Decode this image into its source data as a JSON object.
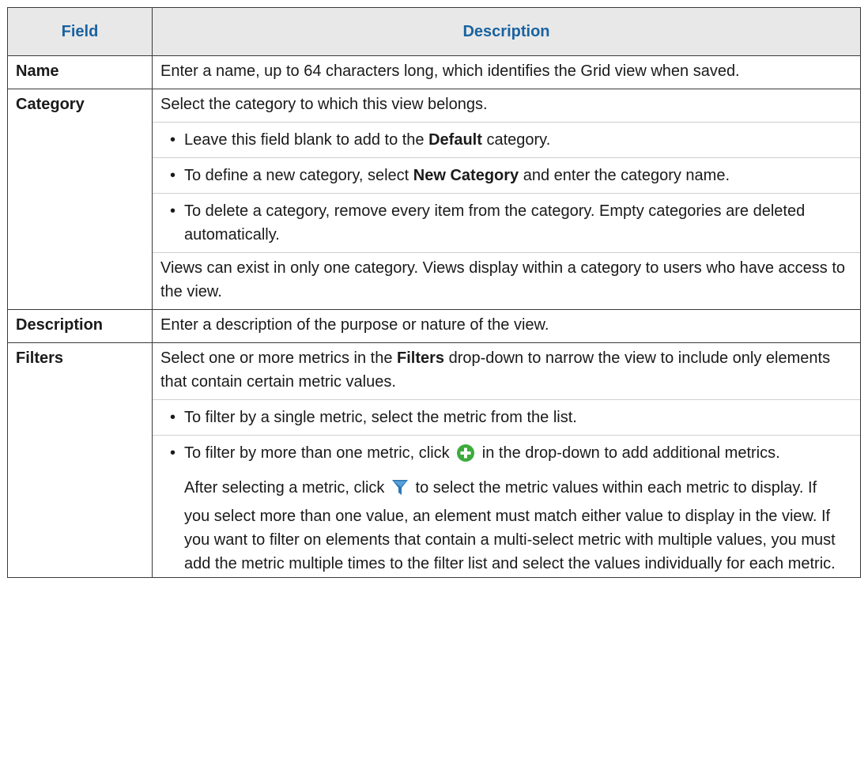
{
  "table": {
    "header": {
      "field": "Field",
      "description": "Description"
    },
    "rows": {
      "name": {
        "field": "Name",
        "text": "Enter a name, up to 64 characters long, which identifies the Grid view when saved."
      },
      "category": {
        "field": "Category",
        "intro": "Select the category to which this view belongs.",
        "bullet1": {
          "before": "Leave this field blank to add to the ",
          "bold": "Default",
          "after": " category."
        },
        "bullet2": {
          "before": "To define a new category, select ",
          "bold": "New Category",
          "after": " and enter the category name."
        },
        "bullet3": {
          "text": "To delete a category, remove every item from the category. Empty categories are deleted automatically."
        },
        "outro": "Views can exist in only one category. Views display within a category to users who have access to the view."
      },
      "description": {
        "field": "Description",
        "text": "Enter a description of the purpose or nature of the view."
      },
      "filters": {
        "field": "Filters",
        "intro_before": "Select one or more metrics in the ",
        "intro_bold": "Filters",
        "intro_after": " drop-down to narrow the view to include only elements that contain certain metric values.",
        "bullet1": "To filter by a single metric, select the metric from the list.",
        "bullet2_before": "To filter by more than one metric, click ",
        "bullet2_after": " in the drop-down to add additional metrics.",
        "bullet2_extra_before": "After selecting a metric, click ",
        "bullet2_extra_after": " to select the metric values within each metric to display. If you select more than one value, an element must match either value to display in the view. If you want to filter on elements that contain a multi-select metric with multiple values, you must add the metric multiple times to the filter list and select the values individually for each metric."
      }
    },
    "bullet_char": "•",
    "icons": {
      "add": "add-circle-icon",
      "filter": "filter-funnel-icon"
    },
    "colors": {
      "header_text": "#1a62a0",
      "header_bg": "#e8e8e8",
      "add_icon": "#3cab3c",
      "filter_icon": "#2a78b8"
    }
  }
}
